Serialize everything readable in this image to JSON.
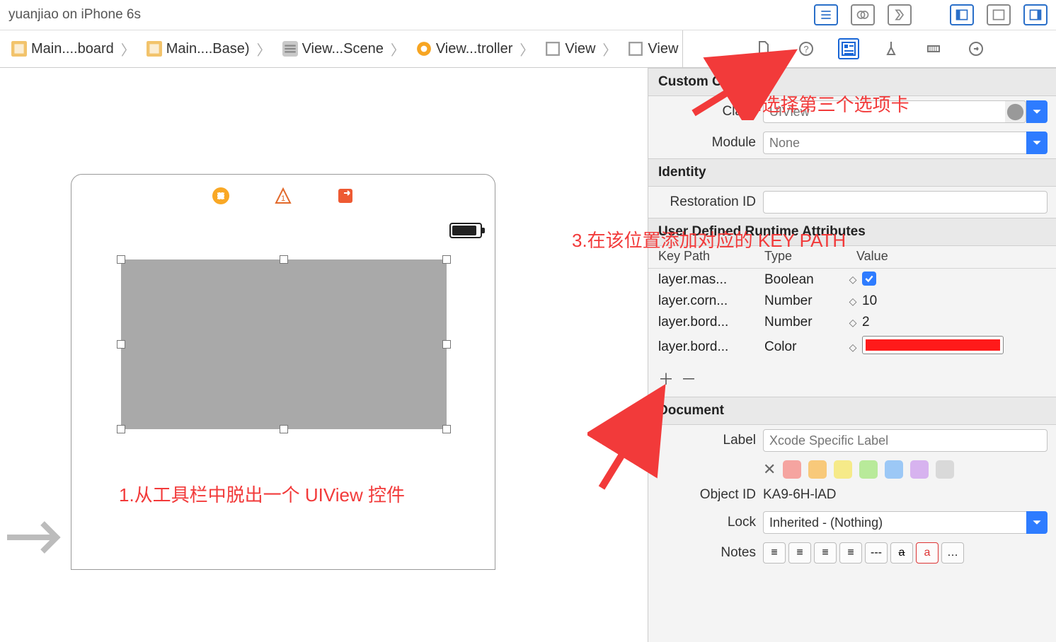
{
  "titlebar": {
    "title": "yuanjiao on iPhone 6s"
  },
  "breadcrumbs": [
    {
      "label": "Main....board"
    },
    {
      "label": "Main....Base)"
    },
    {
      "label": "View...Scene"
    },
    {
      "label": "View...troller"
    },
    {
      "label": "View"
    },
    {
      "label": "View"
    }
  ],
  "annotations": {
    "one": "1.从工具栏中脱出一个 UIView 控件",
    "two": "2.选择第三个选项卡",
    "three": "3.在该位置添加对应的 KEY PATH"
  },
  "inspector": {
    "custom_class": {
      "header": "Custom Class",
      "class_label": "Class",
      "class_placeholder": "UIView",
      "module_label": "Module",
      "module_placeholder": "None"
    },
    "identity": {
      "header": "Identity",
      "restoration_label": "Restoration ID"
    },
    "udra": {
      "header": "User Defined Runtime Attributes",
      "cols": {
        "kp": "Key Path",
        "ty": "Type",
        "va": "Value"
      },
      "rows": [
        {
          "kp": "layer.mas...",
          "ty": "Boolean",
          "val_kind": "check",
          "val": true
        },
        {
          "kp": "layer.corn...",
          "ty": "Number",
          "val_kind": "num",
          "val": "10"
        },
        {
          "kp": "layer.bord...",
          "ty": "Number",
          "val_kind": "num",
          "val": "2"
        },
        {
          "kp": "layer.bord...",
          "ty": "Color",
          "val_kind": "color",
          "val": "#ff1a1a"
        }
      ]
    },
    "document": {
      "header": "Document",
      "label_label": "Label",
      "label_placeholder": "Xcode Specific Label",
      "objectid_label": "Object ID",
      "objectid_value": "KA9-6H-lAD",
      "lock_label": "Lock",
      "lock_value": "Inherited - (Nothing)",
      "notes_label": "Notes",
      "color_swatches": [
        "#f5a4a0",
        "#f8c97a",
        "#f6ea89",
        "#b8ea9a",
        "#9cc8f6",
        "#d7b3ef",
        "#d9d9d9"
      ]
    }
  }
}
